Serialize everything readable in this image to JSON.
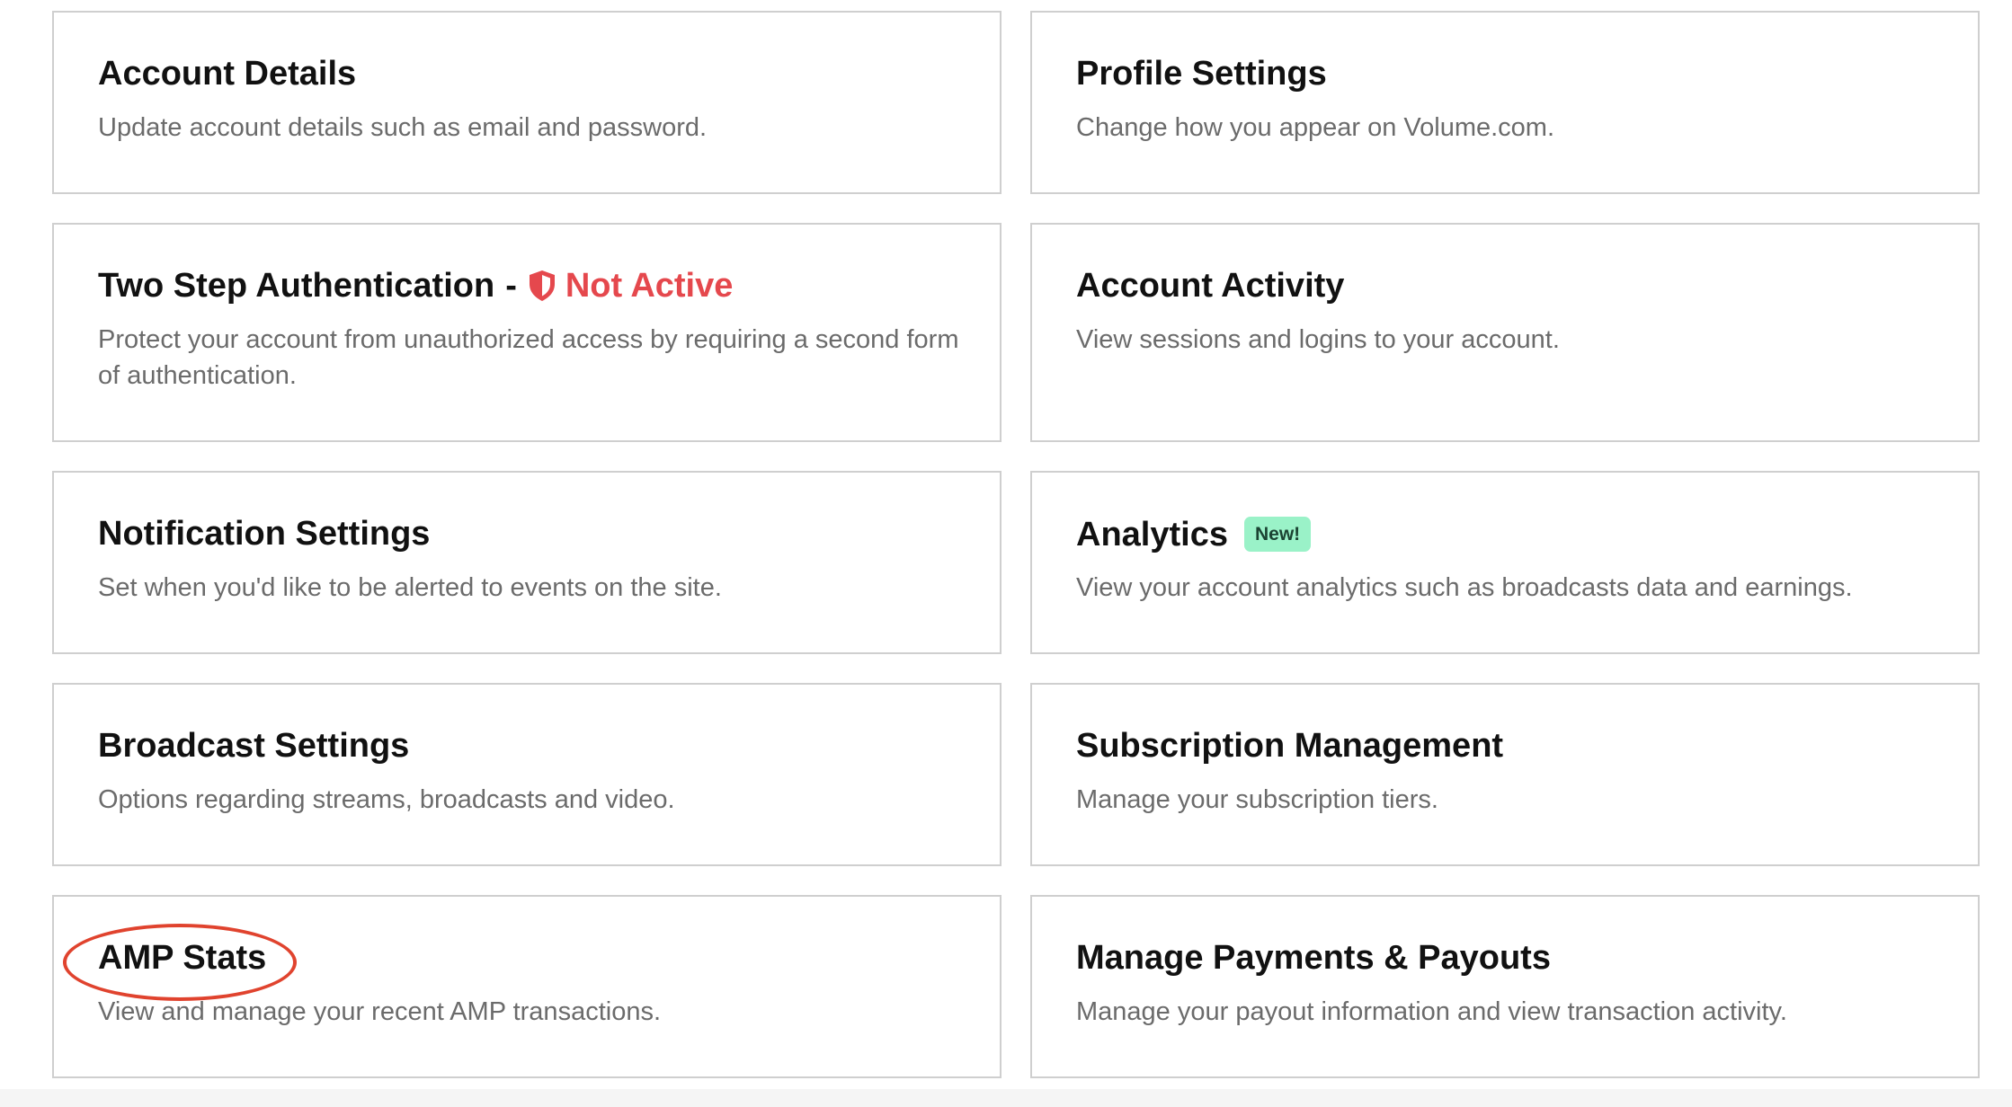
{
  "cards": [
    {
      "title": "Account Details",
      "desc": "Update account details such as email and password."
    },
    {
      "title": "Profile Settings",
      "desc": "Change how you appear on Volume.com."
    },
    {
      "title": "Two Step Authentication",
      "separator": "-",
      "status": "Not Active",
      "status_color": "#e5484d",
      "status_icon": "shield-icon",
      "desc": "Protect your account from unauthorized access by requiring a second form of authentication."
    },
    {
      "title": "Account Activity",
      "desc": "View sessions and logins to your account."
    },
    {
      "title": "Notification Settings",
      "desc": "Set when you'd like to be alerted to events on the site."
    },
    {
      "title": "Analytics",
      "badge": "New!",
      "badge_color": "#9af2c8",
      "desc": "View your account analytics such as broadcasts data and earnings."
    },
    {
      "title": "Broadcast Settings",
      "desc": "Options regarding streams, broadcasts and video."
    },
    {
      "title": "Subscription Management",
      "desc": "Manage your subscription tiers."
    },
    {
      "title": "AMP Stats",
      "desc": "View and manage your recent AMP transactions."
    },
    {
      "title": "Manage Payments & Payouts",
      "desc": "Manage your payout information and view transaction activity."
    }
  ],
  "annotation_color": "#e0432e"
}
